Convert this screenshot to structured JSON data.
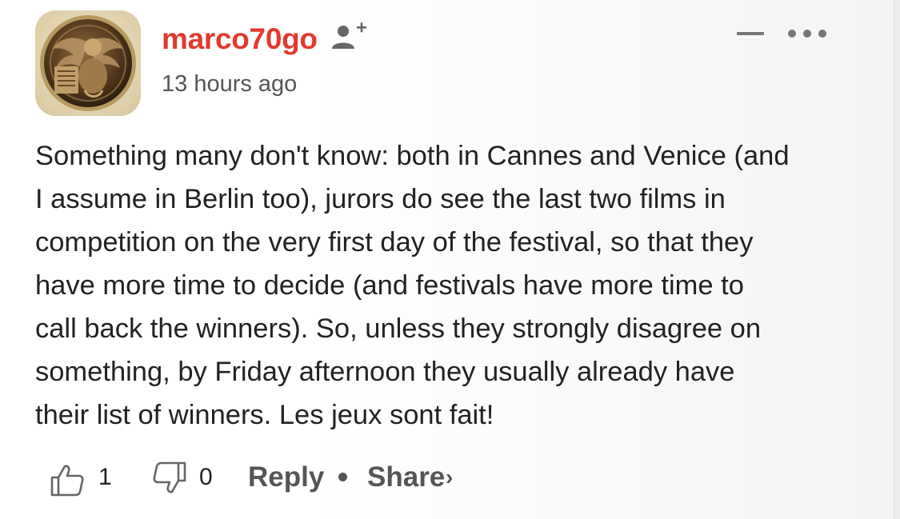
{
  "comment": {
    "author": {
      "username": "marco70go",
      "avatar_icon": "wax-seal-avatar",
      "follow_icon": "add-user-icon",
      "username_color": "#e03a2f"
    },
    "timestamp": "13 hours ago",
    "header_actions": {
      "collapse_icon": "minus-icon",
      "more_icon": "ellipsis-icon"
    },
    "body_lines": [
      "Something many don't know: both in Cannes and Venice (and",
      "I assume in Berlin too), jurors do see the last two films in",
      "competition on the very first day of the festival, so that they",
      "have more time to decide (and festivals have more time to",
      "call back the winners). So, unless they strongly disagree on",
      "something, by Friday afternoon they usually already have",
      "their list of winners. Les jeux sont fait!"
    ],
    "actions": {
      "upvotes": "1",
      "downvotes": "0",
      "reply_label": "Reply",
      "share_label": "Share",
      "share_chevron": "›",
      "upvote_icon": "thumbs-up-icon",
      "downvote_icon": "thumbs-down-icon"
    }
  }
}
